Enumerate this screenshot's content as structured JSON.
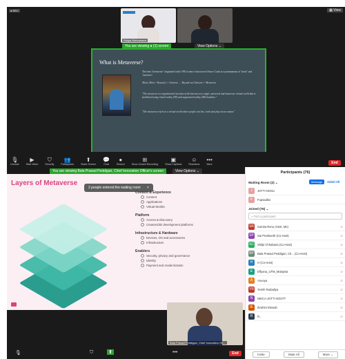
{
  "top_meeting": {
    "top_left_badge": "● REC",
    "speaker_name": "Shilpa Shrivastava",
    "screen_share_banner": "You are viewing ● (1) screen",
    "view_options": "View Options ⌄",
    "slide": {
      "title": "What is Metaverse?",
      "para1": "The term \"metaverse\" originated in the 1992 science fiction novel Snow Crash as a portmanteau of \"meta\" and \"universe\".",
      "para2": "Meta ( Meta = Beyond ) + Universe → Beyond our Universe = Metaverse",
      "quote1": "\"The metaverse is a hypothetical iteration of the Internet as a single, universal and immersive virtual world that is facilitated using virtual reality (VR) and augmented reality (AR) headsets.\"",
      "quote2": "\"The metaverse refers to a virtual world where people can live, work and play via an avatar.\""
    },
    "toolbar": [
      {
        "icon": "mic-icon",
        "glyph": "🎙",
        "label": "Unmute"
      },
      {
        "icon": "video-icon",
        "glyph": "▶",
        "label": "Start Video"
      },
      {
        "icon": "security-icon",
        "glyph": "⛉",
        "label": "Security"
      },
      {
        "icon": "participants-icon",
        "glyph": "👥",
        "label": "Participants"
      },
      {
        "icon": "share-screen-icon",
        "glyph": "⬆",
        "label": "Share Screen"
      },
      {
        "icon": "chat-icon",
        "glyph": "💬",
        "label": "Chat"
      },
      {
        "icon": "record-icon",
        "glyph": "●",
        "label": "Record"
      },
      {
        "icon": "recording-icon",
        "glyph": "⊞",
        "label": "Show Closed Recording"
      },
      {
        "icon": "options-icon",
        "glyph": "▣",
        "label": "Show Captions"
      },
      {
        "icon": "reactions-icon",
        "glyph": "☺",
        "label": "Reactions"
      },
      {
        "icon": "more-icon",
        "glyph": "•••",
        "label": "More"
      }
    ],
    "end_label": "End"
  },
  "bottom_meeting": {
    "screen_share_banner": "You are viewing Bala Prasad Peddigari, Chief Innovation Officer's screen",
    "view_options": "View Options ⌄",
    "notification": "2 people entered the waiting room",
    "notification_close": "×",
    "slide_title": "Layers of Metaverse",
    "sections": [
      {
        "title": "Content & Experience",
        "items": [
          "Content",
          "Applications",
          "Virtual Worlds"
        ]
      },
      {
        "title": "Platform",
        "items": [
          "Access & Discovery",
          "Creators/3D development platforms"
        ]
      },
      {
        "title": "Infrastructure & Hardware",
        "items": [
          "Devices, OS and accessories",
          "Infrastructure"
        ]
      },
      {
        "title": "Enablers",
        "items": [
          "Security, privacy and governance",
          "Identity",
          "Payment and modernization"
        ]
      }
    ],
    "presenter_name": "Bala Prasad Peddigari, Chief Innovation Off...",
    "end_label": "End",
    "colors": {
      "zoom_green": "#2da42f",
      "end_red": "#e02828",
      "slide_title": "#d9437c",
      "layer_teal": "#2a9d8f"
    }
  },
  "participants_panel": {
    "title": "Participants (76)",
    "waiting_room_label": "Waiting Room (2) ⌄",
    "message_button": "Message",
    "admit_all_button": "Admit All",
    "waiting": [
      {
        "initials": "J",
        "name": "JOTTI NOSU",
        "color": "#e6a0a0"
      },
      {
        "initials": "F",
        "name": "Fupsadiko",
        "color": "#e6a0a0"
      }
    ],
    "joined_label": "Joined (76) ⌄",
    "search_placeholder": "Find a participant",
    "joined": [
      {
        "initials": "SR",
        "name": "Sumita Renu (Host, Me)",
        "color": "#c0392b"
      },
      {
        "initials": "SP",
        "name": "Sai Prashanth (Co-Host)",
        "color": "#8e44ad"
      },
      {
        "initials": "SC",
        "name": "Shilpi Chhabaria (Co-Host)",
        "color": "#27ae60"
      },
      {
        "initials": "BP",
        "name": "Bala Prasad Peddigari, Ch... (Co-Host)",
        "color": "#6d8b74"
      },
      {
        "initials": "H",
        "name": "H (Co-Host)",
        "color": "#2980b9"
      },
      {
        "initials": "E",
        "name": "Effyana_UTM_Malaysia",
        "color": "#16a085"
      },
      {
        "initials": "A",
        "name": "Anuoya",
        "color": "#e67e22"
      },
      {
        "initials": "YR",
        "name": "Yemih Radadiya",
        "color": "#c0392b"
      },
      {
        "initials": "N",
        "name": "NIECA-JOTTI NOSTT",
        "color": "#8e44ad"
      },
      {
        "initials": "IE",
        "name": "Ibrahim Elewah",
        "color": "#d35400"
      },
      {
        "initials": "R",
        "name": "R...",
        "color": "#2c3e50"
      }
    ],
    "footer": [
      "Invite",
      "Mute All",
      "More ⌄"
    ],
    "colors": {
      "accent_blue": "#0e71eb"
    }
  }
}
